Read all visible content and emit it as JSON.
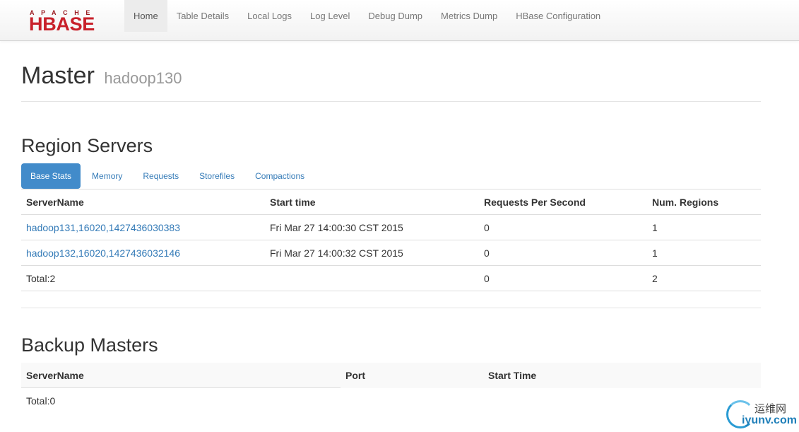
{
  "navbar": {
    "logo_top": "APACHE",
    "logo_main": "HBASE",
    "items": [
      {
        "label": "Home",
        "active": true
      },
      {
        "label": "Table Details",
        "active": false
      },
      {
        "label": "Local Logs",
        "active": false
      },
      {
        "label": "Log Level",
        "active": false
      },
      {
        "label": "Debug Dump",
        "active": false
      },
      {
        "label": "Metrics Dump",
        "active": false
      },
      {
        "label": "HBase Configuration",
        "active": false
      }
    ]
  },
  "page": {
    "title": "Master",
    "subtitle": "hadoop130"
  },
  "region_servers": {
    "title": "Region Servers",
    "tabs": [
      {
        "label": "Base Stats",
        "active": true
      },
      {
        "label": "Memory",
        "active": false
      },
      {
        "label": "Requests",
        "active": false
      },
      {
        "label": "Storefiles",
        "active": false
      },
      {
        "label": "Compactions",
        "active": false
      }
    ],
    "columns": [
      "ServerName",
      "Start time",
      "Requests Per Second",
      "Num. Regions"
    ],
    "rows": [
      {
        "server": "hadoop131,16020,1427436030383",
        "start": "Fri Mar 27 14:00:30 CST 2015",
        "rps": "0",
        "regions": "1"
      },
      {
        "server": "hadoop132,16020,1427436032146",
        "start": "Fri Mar 27 14:00:32 CST 2015",
        "rps": "0",
        "regions": "1"
      }
    ],
    "total": {
      "label": "Total:2",
      "rps": "0",
      "regions": "2"
    }
  },
  "backup_masters": {
    "title": "Backup Masters",
    "columns": [
      "ServerName",
      "Port",
      "Start Time"
    ],
    "total": "Total:0"
  },
  "watermark": {
    "line1": "运维网",
    "line2": "iyunv.com",
    "accent": "#2a9bd3"
  }
}
